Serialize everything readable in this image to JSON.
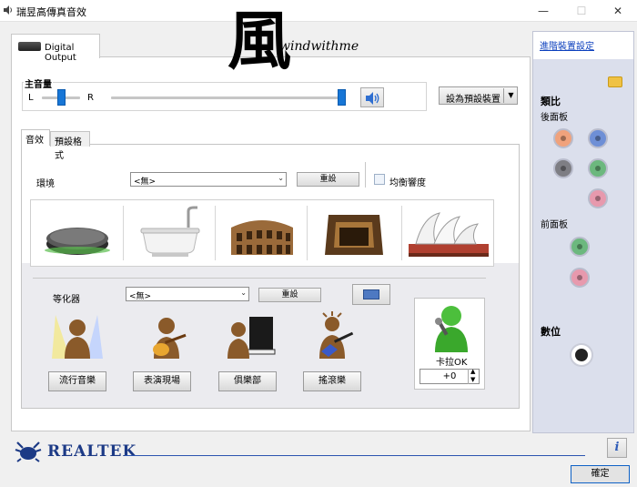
{
  "window": {
    "title": "瑞昱高傳真音效",
    "controls": {
      "minimize": "—",
      "maximize": "☐",
      "close": "✕"
    }
  },
  "device_tab": {
    "label": "Digital Output"
  },
  "watermark": {
    "char": "風",
    "text": "windwithme"
  },
  "master_volume": {
    "label": "主音量",
    "left_label": "L",
    "right_label": "R",
    "balance": 0.5,
    "level": 1.0
  },
  "set_default_device": {
    "label": "設為預設裝置",
    "arrow": "▼"
  },
  "inner_tabs": [
    {
      "label": "音效",
      "selected": true
    },
    {
      "label": "預設格式",
      "selected": false
    }
  ],
  "environment": {
    "label": "環境",
    "selected": "<無>",
    "reset_label": "重設",
    "loudness_label": "均衡響度",
    "loudness_checked": false,
    "presets": [
      "stone-disc",
      "bathtub",
      "colosseum",
      "stage",
      "opera-house"
    ]
  },
  "equalizer": {
    "label": "等化器",
    "selected": "<無>",
    "reset_label": "重設",
    "presets": [
      "流行音樂",
      "表演現場",
      "俱樂部",
      "搖滾樂"
    ]
  },
  "karaoke": {
    "label": "卡拉OK",
    "value": "+0"
  },
  "side_panel": {
    "advanced_link": "進階裝置設定",
    "analog_label": "類比",
    "rear_label": "後面板",
    "front_label": "前面板",
    "digital_label": "數位",
    "colors": {
      "rear": [
        "#f0a27c",
        "#6e8fd6",
        "#7e7e84",
        "#6cb87e",
        "#e799ad"
      ],
      "front": [
        "#6cb87e",
        "#e799ad"
      ]
    }
  },
  "footer": {
    "brand": "REALTEK",
    "ok_label": "確定",
    "info": "i"
  }
}
